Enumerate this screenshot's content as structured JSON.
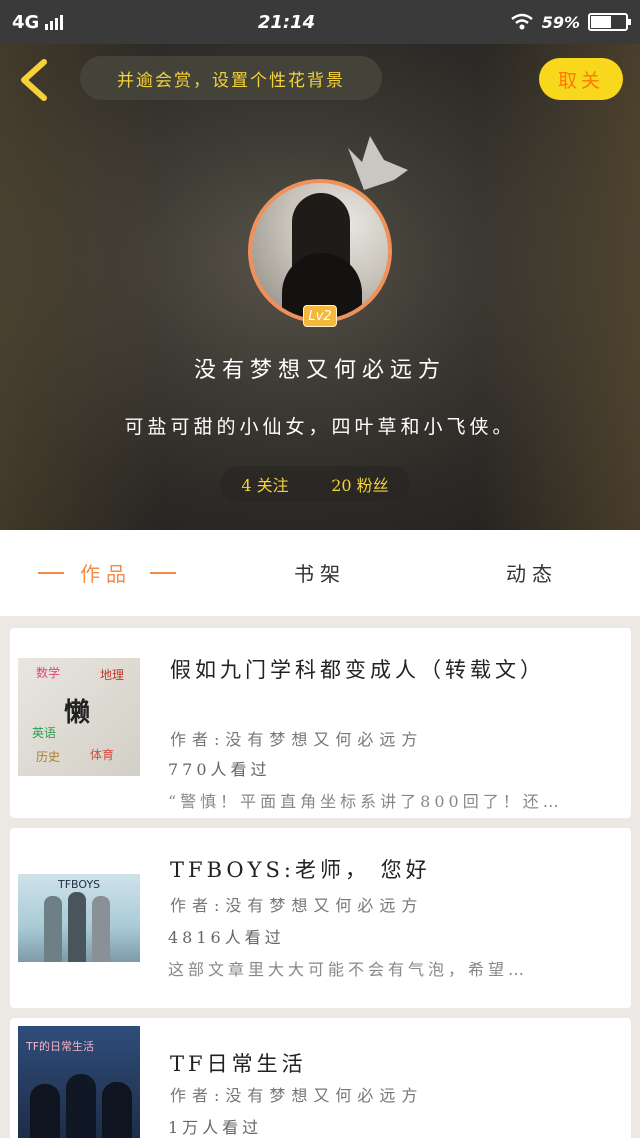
{
  "status": {
    "network": "4G",
    "time": "21:14",
    "battery": "59%",
    "battery_level": 0.59
  },
  "header": {
    "topic": "并逾会赏，设置个性花背景",
    "follow_label": "取关",
    "level": "Lv2",
    "username": "没有梦想又何必远方",
    "bio": "可盐可甜的小仙女，四叶草和小飞侠。",
    "following": "4 关注",
    "followers": "20 粉丝"
  },
  "tabs": [
    {
      "label": "作品",
      "active": true
    },
    {
      "label": "书架",
      "active": false
    },
    {
      "label": "动态",
      "active": false
    }
  ],
  "works": [
    {
      "title": "假如九门学科都变成人（转载文）",
      "author": "作者:没有梦想又何必远方",
      "views": "770人看过",
      "snippet": "“警慎！平面直角坐标系讲了800回了！还…",
      "cover_labels": [
        "数学",
        "地理",
        "英语",
        "懒",
        "历史",
        "体育"
      ]
    },
    {
      "title": "TFBOYS:老师， 您好",
      "author": "作者:没有梦想又何必远方",
      "views": "4816人看过",
      "snippet": "这部文章里大大可能不会有气泡，希望…",
      "cover_labels": [
        "TFBOYS"
      ]
    },
    {
      "title": "TF日常生活",
      "author": "作者:没有梦想又何必远方",
      "views": "1万人看过",
      "snippet": "",
      "cover_labels": [
        "TF的日常生活"
      ]
    }
  ],
  "colors": {
    "accent_yellow": "#f8d81c",
    "accent_orange": "#f08c4a",
    "header_dark": "#2c2a26"
  }
}
